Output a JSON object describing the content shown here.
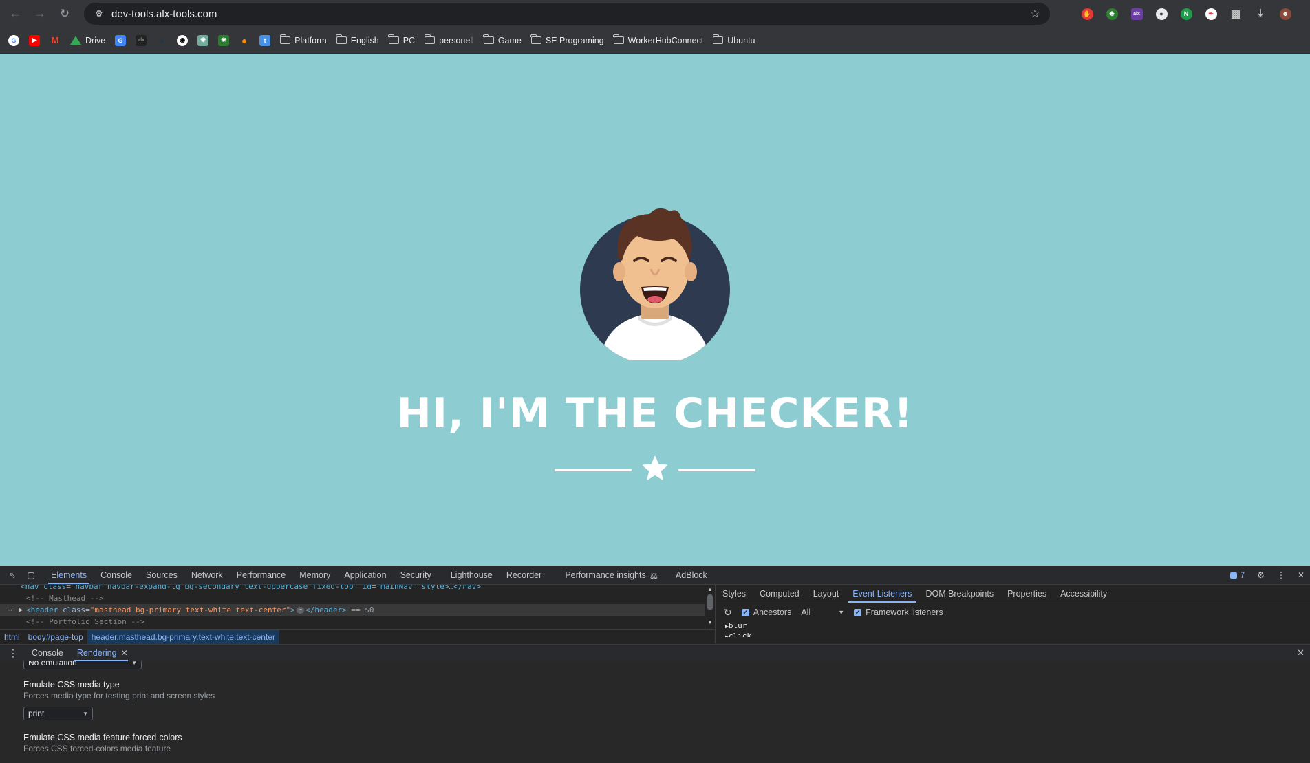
{
  "browser": {
    "url": "dev-tools.alx-tools.com",
    "bookmarks": {
      "drive_label": "Drive",
      "folders": [
        "Platform",
        "English",
        "PC",
        "personell",
        "Game",
        "SE Programing",
        "WorkerHubConnect",
        "Ubuntu"
      ]
    },
    "extensions": [
      "adblock-icon",
      "chatgpt-icon",
      "alx-icon",
      "compass-icon",
      "n-icon",
      "pen-icon",
      "puzzle-icon",
      "download-icon",
      "profile-avatar"
    ]
  },
  "page": {
    "heading": "HI, I'M THE CHECKER!",
    "background_color": "#8dcdd1"
  },
  "devtools": {
    "tabs": [
      "Elements",
      "Console",
      "Sources",
      "Network",
      "Performance",
      "Memory",
      "Application",
      "Security",
      "Lighthouse",
      "Recorder",
      "Performance insights",
      "AdBlock"
    ],
    "active_tab": "Elements",
    "issues_count": "7",
    "elements": {
      "line1": "<nav class=\"navbar navbar-expand-lg bg-secondary text-uppercase fixed-top\" id=\"mainNav\" style>…</nav>",
      "line2": "<!-- Masthead -->",
      "line3_tag_open": "<header",
      "line3_attr": " class=",
      "line3_val": "\"masthead bg-primary text-white text-center\"",
      "line3_rest": ">",
      "line3_close": "</header>",
      "line3_sel": " == $0",
      "line4": "<!-- Portfolio Section -->"
    },
    "breadcrumb": [
      "html",
      "body#page-top",
      "header.masthead.bg-primary.text-white.text-center"
    ],
    "side_tabs": [
      "Styles",
      "Computed",
      "Layout",
      "Event Listeners",
      "DOM Breakpoints",
      "Properties",
      "Accessibility"
    ],
    "active_side_tab": "Event Listeners",
    "listeners": {
      "ancestors_label": "Ancestors",
      "filter_value": "All",
      "framework_label": "Framework listeners",
      "events": [
        "blur",
        "click"
      ]
    },
    "drawer": {
      "tabs": [
        "Console",
        "Rendering"
      ],
      "active_tab": "Rendering"
    },
    "rendering": {
      "emulation_value": "No emulation",
      "css_media_title": "Emulate CSS media type",
      "css_media_desc": "Forces media type for testing print and screen styles",
      "css_media_value": "print",
      "forced_colors_title": "Emulate CSS media feature forced-colors",
      "forced_colors_desc": "Forces CSS forced-colors media feature"
    }
  }
}
